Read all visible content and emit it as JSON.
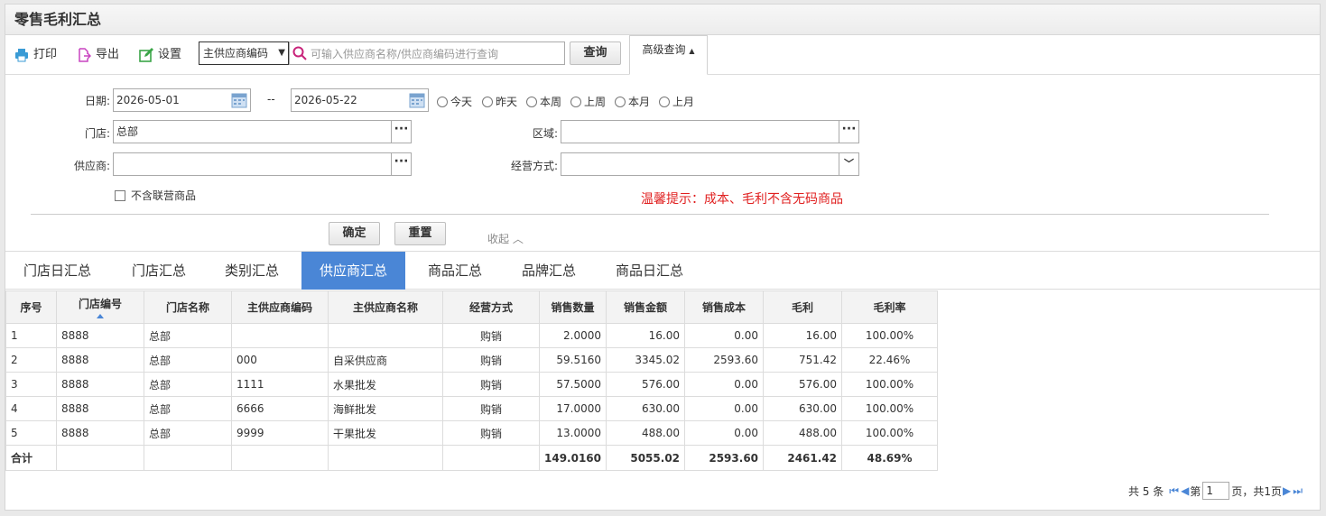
{
  "page": {
    "title": "零售毛利汇总"
  },
  "toolbar": {
    "print": "打印",
    "export": "导出",
    "settings": "设置",
    "search_type": "主供应商编码",
    "search_placeholder": "可输入供应商名称/供应商编码进行查询",
    "query": "查询",
    "advanced": "高级查询"
  },
  "filters": {
    "date_label": "日期:",
    "date_from": "2026-05-01",
    "date_sep": "--",
    "date_to": "2026-05-22",
    "quick": [
      "今天",
      "昨天",
      "本周",
      "上周",
      "本月",
      "上月"
    ],
    "store_label": "门店:",
    "store_value": "总部",
    "region_label": "区域:",
    "region_value": "",
    "supplier_label": "供应商:",
    "supplier_value": "",
    "mode_label": "经营方式:",
    "mode_value": "",
    "exclude_joint": "不含联营商品",
    "tip": "温馨提示：成本、毛利不含无码商品",
    "confirm": "确定",
    "reset": "重置",
    "collapse": "收起"
  },
  "tabs": [
    "门店日汇总",
    "门店汇总",
    "类别汇总",
    "供应商汇总",
    "商品汇总",
    "品牌汇总",
    "商品日汇总"
  ],
  "active_tab": "供应商汇总",
  "table": {
    "headers": [
      "序号",
      "门店编号",
      "门店名称",
      "主供应商编码",
      "主供应商名称",
      "经营方式",
      "销售数量",
      "销售金额",
      "销售成本",
      "毛利",
      "毛利率"
    ],
    "rows": [
      [
        "1",
        "8888",
        "总部",
        "",
        "",
        "购销",
        "2.0000",
        "16.00",
        "0.00",
        "16.00",
        "100.00%"
      ],
      [
        "2",
        "8888",
        "总部",
        "000",
        "自采供应商",
        "购销",
        "59.5160",
        "3345.02",
        "2593.60",
        "751.42",
        "22.46%"
      ],
      [
        "3",
        "8888",
        "总部",
        "1111",
        "水果批发",
        "购销",
        "57.5000",
        "576.00",
        "0.00",
        "576.00",
        "100.00%"
      ],
      [
        "4",
        "8888",
        "总部",
        "6666",
        "海鲜批发",
        "购销",
        "17.0000",
        "630.00",
        "0.00",
        "630.00",
        "100.00%"
      ],
      [
        "5",
        "8888",
        "总部",
        "9999",
        "干果批发",
        "购销",
        "13.0000",
        "488.00",
        "0.00",
        "488.00",
        "100.00%"
      ]
    ],
    "total": [
      "合计",
      "",
      "",
      "",
      "",
      "",
      "149.0160",
      "5055.02",
      "2593.60",
      "2461.42",
      "48.69%"
    ]
  },
  "pager": {
    "total_text": "共 5 条",
    "page_label": "第",
    "page_value": "1",
    "suffix": "页，共1页"
  }
}
